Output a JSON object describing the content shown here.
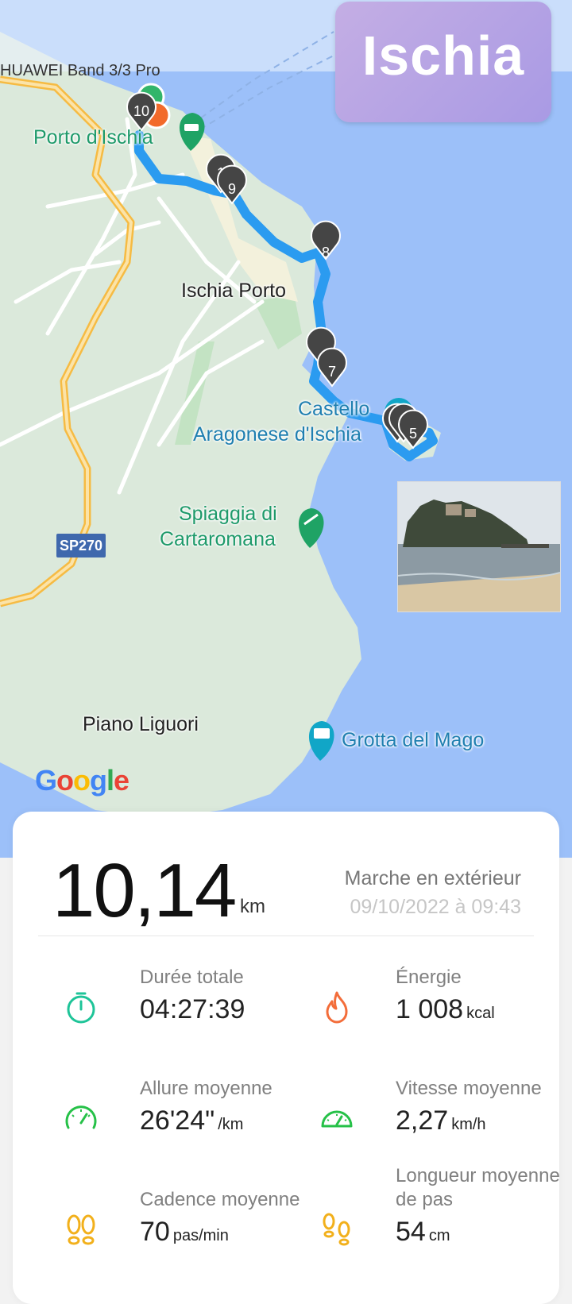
{
  "map": {
    "device_label": "HUAWEI Band 3/3 Pro",
    "title": "Ischia",
    "labels": {
      "porto_ischia": "Porto d'Ischia",
      "ischia_porto": "Ischia Porto",
      "castello_1": "Castello",
      "castello_2": "Aragonese d'Ischia",
      "spiaggia_1": "Spiaggia di",
      "spiaggia_2": "Cartaromana",
      "piano": "Piano Liguori",
      "grotta": "Grotta del Mago",
      "road": "SP270"
    },
    "markers": [
      "10",
      "1",
      "9",
      "8",
      "7",
      "5"
    ],
    "logo": "Google",
    "colors": {
      "route": "#2b9bf0",
      "sea": "#9cc0f9",
      "land": "#d9e9d9",
      "road": "#f5bd44"
    }
  },
  "summary": {
    "distance": "10,14",
    "distance_unit": "km",
    "activity": "Marche en extérieur",
    "date": "09/10/2022 à 09:43"
  },
  "stats": [
    {
      "label": "Durée totale",
      "value": "04:27:39",
      "unit": "",
      "icon": "stopwatch-icon"
    },
    {
      "label": "Énergie",
      "value": "1 008",
      "unit": "kcal",
      "icon": "flame-icon"
    },
    {
      "label": "Allure moyenne",
      "value": "26'24\"",
      "unit": "/km",
      "icon": "speedometer-icon"
    },
    {
      "label": "Vitesse moyenne",
      "value": "2,27",
      "unit": "km/h",
      "icon": "gauge-icon"
    },
    {
      "label": "Cadence moyenne",
      "value": "70",
      "unit": "pas/min",
      "icon": "footprints-icon"
    },
    {
      "label": "Longueur moyenne de pas",
      "value": "54",
      "unit": "cm",
      "icon": "footsteps-icon"
    }
  ]
}
